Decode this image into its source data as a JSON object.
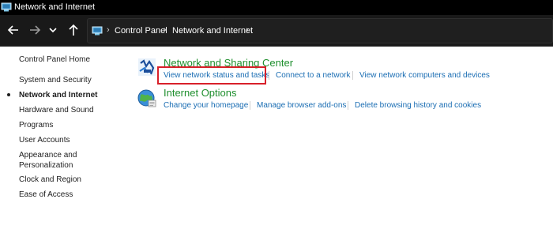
{
  "window": {
    "title": "Network and Internet"
  },
  "navigation": {
    "back_icon": "arrow-left-icon",
    "forward_icon": "arrow-right-icon",
    "recent_icon": "chevron-down-icon",
    "up_icon": "arrow-up-icon",
    "breadcrumbs": [
      "Control Panel",
      "Network and Internet"
    ]
  },
  "sidebar": {
    "items": [
      {
        "label": "Control Panel Home",
        "active": false
      },
      {
        "label": "System and Security",
        "active": false
      },
      {
        "label": "Network and Internet",
        "active": true
      },
      {
        "label": "Hardware and Sound",
        "active": false
      },
      {
        "label": "Programs",
        "active": false
      },
      {
        "label": "User Accounts",
        "active": false
      },
      {
        "label": "Appearance and",
        "active": false
      },
      {
        "label": "Personalization",
        "active": false
      },
      {
        "label": "Clock and Region",
        "active": false
      },
      {
        "label": "Ease of Access",
        "active": false
      }
    ]
  },
  "categories": [
    {
      "title": "Network and Sharing Center",
      "icon": "network-sharing-icon",
      "links": [
        "View network status and tasks",
        "Connect to a network",
        "View network computers and devices"
      ],
      "highlighted_link": "View network status and tasks"
    },
    {
      "title": "Internet Options",
      "icon": "internet-globe-icon",
      "links": [
        "Change your homepage",
        "Manage browser add-ons",
        "Delete browsing history and cookies"
      ]
    }
  ],
  "colors": {
    "title_bar": "#000000",
    "nav_bar": "#191919",
    "category_title": "#1f8f2e",
    "link": "#1a6db3",
    "highlight": "#d8202a"
  }
}
